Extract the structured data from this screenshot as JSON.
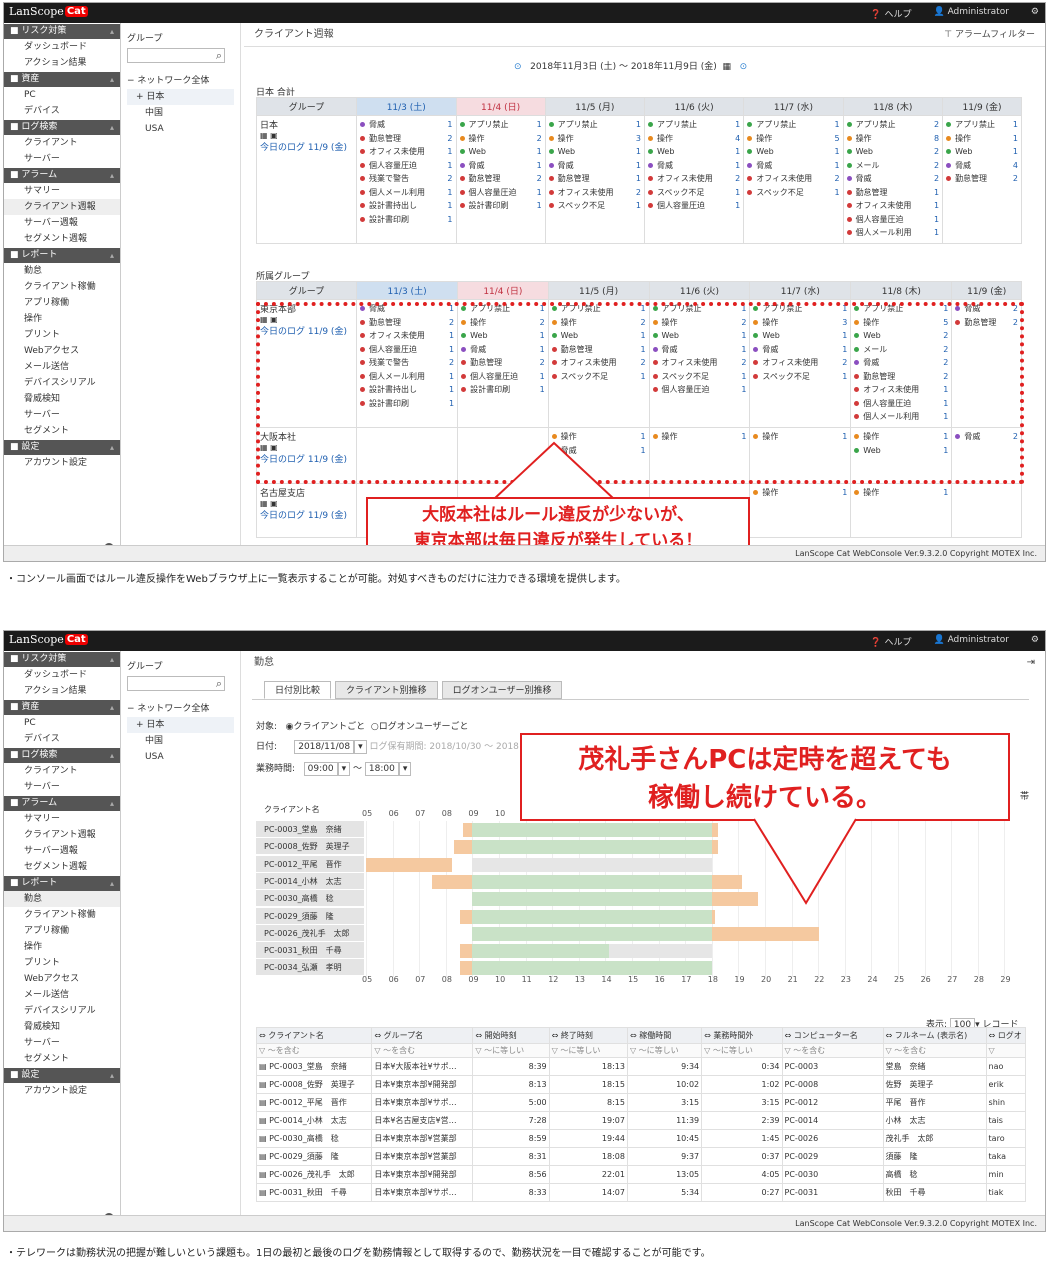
{
  "app": {
    "logo_text": "LanScope",
    "logo_badge": "Cat",
    "help": "ヘルプ",
    "user": "Administrator",
    "footer": "LanScope Cat WebConsole Ver.9.3.2.0 Copyright MOTEX Inc."
  },
  "sidebar": {
    "sections": [
      {
        "title": "リスク対策",
        "items": [
          "ダッシュボード",
          "アクション結果"
        ]
      },
      {
        "title": "資産",
        "items": [
          "PC",
          "デバイス"
        ]
      },
      {
        "title": "ログ検索",
        "items": [
          "クライアント",
          "サーバー"
        ]
      },
      {
        "title": "アラーム",
        "items": [
          "サマリー",
          "クライアント週報",
          "サーバー週報",
          "セグメント週報"
        ]
      },
      {
        "title": "レポート",
        "items": [
          "勤怠",
          "クライアント稼働",
          "アプリ稼働",
          "操作",
          "プリント",
          "Webアクセス",
          "メール送信",
          "デバイスシリアル",
          "脅威検知",
          "サーバー",
          "セグメント"
        ]
      },
      {
        "title": "設定",
        "items": [
          "アカウント設定"
        ]
      }
    ]
  },
  "groups": {
    "title": "グループ",
    "tree": [
      "ネットワーク全体",
      "日本",
      "中国",
      "USA"
    ]
  },
  "screen1": {
    "title": "クライアント週報",
    "filter": "アラームフィルター",
    "range": "2018年11月3日 (土) ～ 2018年11月9日 (金)",
    "japan_total": "日本 合計",
    "own_group": "所属グループ",
    "group_header": "グループ",
    "days": [
      "11/3 (土)",
      "11/4 (日)",
      "11/5 (月)",
      "11/6 (火)",
      "11/7 (水)",
      "11/8 (木)",
      "11/9 (金)"
    ],
    "log_link": "今日のログ 11/9 (金)",
    "japan": {
      "name": "日本",
      "cells": [
        [
          [
            "p",
            "脅威",
            "1"
          ],
          [
            "r",
            "勤怠管理",
            "2"
          ],
          [
            "r",
            "オフィス未使用",
            "1"
          ],
          [
            "r",
            "個人容量圧迫",
            "1"
          ],
          [
            "r",
            "残業で警告",
            "2"
          ],
          [
            "r",
            "個人メール利用",
            "1"
          ],
          [
            "r",
            "設計書持出し",
            "1"
          ],
          [
            "r",
            "設計書印刷",
            "1"
          ]
        ],
        [
          [
            "g",
            "アプリ禁止",
            "1"
          ],
          [
            "o",
            "操作",
            "2"
          ],
          [
            "g",
            "Web",
            "1"
          ],
          [
            "p",
            "脅威",
            "1"
          ],
          [
            "r",
            "勤怠管理",
            "2"
          ],
          [
            "r",
            "個人容量圧迫",
            "1"
          ],
          [
            "r",
            "設計書印刷",
            "1"
          ]
        ],
        [
          [
            "g",
            "アプリ禁止",
            "1"
          ],
          [
            "o",
            "操作",
            "3"
          ],
          [
            "g",
            "Web",
            "1"
          ],
          [
            "p",
            "脅威",
            "1"
          ],
          [
            "r",
            "勤怠管理",
            "1"
          ],
          [
            "r",
            "オフィス未使用",
            "2"
          ],
          [
            "r",
            "スペック不足",
            "1"
          ]
        ],
        [
          [
            "g",
            "アプリ禁止",
            "1"
          ],
          [
            "o",
            "操作",
            "4"
          ],
          [
            "g",
            "Web",
            "1"
          ],
          [
            "p",
            "脅威",
            "1"
          ],
          [
            "r",
            "オフィス未使用",
            "2"
          ],
          [
            "r",
            "スペック不足",
            "1"
          ],
          [
            "r",
            "個人容量圧迫",
            "1"
          ]
        ],
        [
          [
            "g",
            "アプリ禁止",
            "1"
          ],
          [
            "o",
            "操作",
            "5"
          ],
          [
            "g",
            "Web",
            "1"
          ],
          [
            "p",
            "脅威",
            "1"
          ],
          [
            "r",
            "オフィス未使用",
            "2"
          ],
          [
            "r",
            "スペック不足",
            "1"
          ]
        ],
        [
          [
            "g",
            "アプリ禁止",
            "2"
          ],
          [
            "o",
            "操作",
            "8"
          ],
          [
            "g",
            "Web",
            "2"
          ],
          [
            "g",
            "メール",
            "2"
          ],
          [
            "p",
            "脅威",
            "2"
          ],
          [
            "r",
            "勤怠管理",
            "1"
          ],
          [
            "r",
            "オフィス未使用",
            "1"
          ],
          [
            "r",
            "個人容量圧迫",
            "1"
          ],
          [
            "r",
            "個人メール利用",
            "1"
          ]
        ],
        [
          [
            "g",
            "アプリ禁止",
            "1"
          ],
          [
            "o",
            "操作",
            "1"
          ],
          [
            "g",
            "Web",
            "1"
          ],
          [
            "p",
            "脅威",
            "4"
          ],
          [
            "r",
            "勤怠管理",
            "2"
          ]
        ]
      ]
    },
    "tokyo": {
      "name": "東京本部",
      "cells": [
        [
          [
            "p",
            "脅威",
            "1"
          ],
          [
            "r",
            "勤怠管理",
            "2"
          ],
          [
            "r",
            "オフィス未使用",
            "1"
          ],
          [
            "r",
            "個人容量圧迫",
            "1"
          ],
          [
            "r",
            "残業で警告",
            "2"
          ],
          [
            "r",
            "個人メール利用",
            "1"
          ],
          [
            "r",
            "設計書持出し",
            "1"
          ],
          [
            "r",
            "設計書印刷",
            "1"
          ]
        ],
        [
          [
            "g",
            "アプリ禁止",
            "1"
          ],
          [
            "o",
            "操作",
            "2"
          ],
          [
            "g",
            "Web",
            "1"
          ],
          [
            "p",
            "脅威",
            "1"
          ],
          [
            "r",
            "勤怠管理",
            "2"
          ],
          [
            "r",
            "個人容量圧迫",
            "1"
          ],
          [
            "r",
            "設計書印刷",
            "1"
          ]
        ],
        [
          [
            "g",
            "アプリ禁止",
            "1"
          ],
          [
            "o",
            "操作",
            "2"
          ],
          [
            "g",
            "Web",
            "1"
          ],
          [
            "r",
            "勤怠管理",
            "1"
          ],
          [
            "r",
            "オフィス未使用",
            "2"
          ],
          [
            "r",
            "スペック不足",
            "1"
          ]
        ],
        [
          [
            "g",
            "アプリ禁止",
            "1"
          ],
          [
            "o",
            "操作",
            "2"
          ],
          [
            "g",
            "Web",
            "1"
          ],
          [
            "p",
            "脅威",
            "1"
          ],
          [
            "r",
            "オフィス未使用",
            "2"
          ],
          [
            "r",
            "スペック不足",
            "1"
          ],
          [
            "r",
            "個人容量圧迫",
            "1"
          ]
        ],
        [
          [
            "g",
            "アプリ禁止",
            "1"
          ],
          [
            "o",
            "操作",
            "3"
          ],
          [
            "g",
            "Web",
            "1"
          ],
          [
            "p",
            "脅威",
            "1"
          ],
          [
            "r",
            "オフィス未使用",
            "2"
          ],
          [
            "r",
            "スペック不足",
            "1"
          ]
        ],
        [
          [
            "g",
            "アプリ禁止",
            "1"
          ],
          [
            "o",
            "操作",
            "5"
          ],
          [
            "g",
            "Web",
            "2"
          ],
          [
            "g",
            "メール",
            "2"
          ],
          [
            "p",
            "脅威",
            "2"
          ],
          [
            "r",
            "勤怠管理",
            "2"
          ],
          [
            "r",
            "オフィス未使用",
            "1"
          ],
          [
            "r",
            "個人容量圧迫",
            "1"
          ],
          [
            "r",
            "個人メール利用",
            "1"
          ]
        ],
        [
          [
            "p",
            "脅威",
            "2"
          ],
          [
            "r",
            "勤怠管理",
            "2"
          ]
        ]
      ]
    },
    "osaka": {
      "name": "大阪本社",
      "cells": [
        [],
        [],
        [
          [
            "o",
            "操作",
            "1"
          ],
          [
            "p",
            "脅威",
            "1"
          ]
        ],
        [
          [
            "o",
            "操作",
            "1"
          ]
        ],
        [
          [
            "o",
            "操作",
            "1"
          ]
        ],
        [
          [
            "o",
            "操作",
            "1"
          ],
          [
            "g",
            "Web",
            "1"
          ]
        ],
        [
          [
            "p",
            "脅威",
            "2"
          ]
        ]
      ]
    },
    "nagoya": {
      "name": "名古屋支店",
      "cells": [
        [],
        [],
        [],
        [],
        [
          [
            "o",
            "操作",
            "1"
          ]
        ],
        [
          [
            "o",
            "操作",
            "1"
          ]
        ],
        []
      ]
    },
    "callout": [
      "大阪本社はルール違反が少ないが、",
      "東京本部は毎日違反が発生している！"
    ],
    "note": "・コンソール画面ではルール違反操作をWebブラウザ上に一覧表示することが可能。対処すべきものだけに注力できる環境を提供します。"
  },
  "screen2": {
    "title": "勤怠",
    "tabs": [
      "日付別比較",
      "クライアント別推移",
      "ログオンユーザー別推移"
    ],
    "target_label": "対象:",
    "target_opt1": "クライアントごと",
    "target_opt2": "ログオンユーザーごと",
    "date_label": "日付:",
    "date_value": "2018/11/08",
    "log_period": "ログ保有期間: 2018/10/30 ～ 2018",
    "hours_label": "業務時間:",
    "start": "09:00",
    "end": "18:00",
    "tilde": "～",
    "chart_header": "クライアント名",
    "right_edge_label": "帯",
    "chart_data": {
      "type": "bar",
      "hours": [
        "05",
        "06",
        "07",
        "08",
        "09",
        "10",
        "11",
        "12",
        "13",
        "14",
        "15",
        "16",
        "17",
        "18",
        "19",
        "20",
        "21",
        "22",
        "23",
        "24",
        "25",
        "26",
        "27",
        "28",
        "29"
      ],
      "clients": [
        "PC-0003_堂島　奈緒",
        "PC-0008_佐野　英理子",
        "PC-0012_平尾　晋作",
        "PC-0014_小林　太志",
        "PC-0030_高橋　稔",
        "PC-0029_須藤　隆",
        "PC-0026_茂礼手　太郎",
        "PC-0031_秋田　千尋",
        "PC-0034_弘瀬　孝明"
      ],
      "start": [
        8.65,
        8.3,
        5.0,
        7.47,
        8.98,
        8.52,
        9.0,
        8.55,
        8.55
      ],
      "end": [
        18.22,
        18.25,
        8.25,
        19.12,
        19.73,
        18.13,
        22.02,
        14.12,
        18.0
      ],
      "business_hours": [
        9,
        18
      ]
    },
    "display_label": "表示:",
    "display_count": "100",
    "record_label": "レコード",
    "columns": [
      "クライアント名",
      "グループ名",
      "開始時刻",
      "終了時刻",
      "稼働時間",
      "業務時間外",
      "コンピューター名",
      "フルネーム (表示名)",
      "ログオ"
    ],
    "filters": [
      "～を含む",
      "～を含む",
      "～に等しい",
      "～に等しい",
      "～に等しい",
      "～に等しい",
      "～を含む",
      "～を含む"
    ],
    "rows": [
      [
        "PC-0003_堂島　奈緒",
        "日本¥大阪本社¥サポ…",
        "8:39",
        "18:13",
        "9:34",
        "0:34",
        "PC-0003",
        "堂島　奈緒",
        "nao"
      ],
      [
        "PC-0008_佐野　英理子",
        "日本¥東京本部¥開発部",
        "8:13",
        "18:15",
        "10:02",
        "1:02",
        "PC-0008",
        "佐野　英理子",
        "erik"
      ],
      [
        "PC-0012_平尾　晋作",
        "日本¥東京本部¥サポ…",
        "5:00",
        "8:15",
        "3:15",
        "3:15",
        "PC-0012",
        "平尾　晋作",
        "shin"
      ],
      [
        "PC-0014_小林　太志",
        "日本¥名古屋支店¥営…",
        "7:28",
        "19:07",
        "11:39",
        "2:39",
        "PC-0014",
        "小林　太志",
        "tais"
      ],
      [
        "PC-0030_高橋　稔",
        "日本¥東京本部¥営業部",
        "8:59",
        "19:44",
        "10:45",
        "1:45",
        "PC-0026",
        "茂礼手　太郎",
        "taro"
      ],
      [
        "PC-0029_須藤　隆",
        "日本¥東京本部¥営業部",
        "8:31",
        "18:08",
        "9:37",
        "0:37",
        "PC-0029",
        "須藤　隆",
        "taka"
      ],
      [
        "PC-0026_茂礼手　太郎",
        "日本¥東京本部¥開発部",
        "8:56",
        "22:01",
        "13:05",
        "4:05",
        "PC-0030",
        "高橋　稔",
        "min"
      ],
      [
        "PC-0031_秋田　千尋",
        "日本¥東京本部¥サポ…",
        "8:33",
        "14:07",
        "5:34",
        "0:27",
        "PC-0031",
        "秋田　千尋",
        "tiak"
      ]
    ],
    "callout": [
      "茂礼手さんPCは定時を超えても",
      "稼働し続けている。"
    ],
    "note": "・テレワークは勤務状況の把握が難しいという課題も。1日の最初と最後のログを勤務情報として取得するので、勤務状況を一目で確認することが可能です。"
  }
}
